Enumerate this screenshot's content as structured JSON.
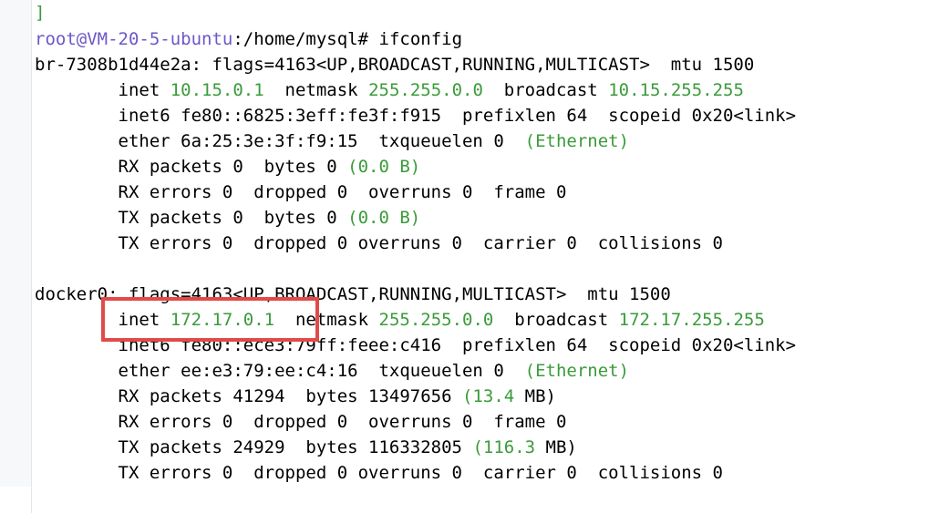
{
  "terminal": {
    "top_bracket": "]",
    "prompt": {
      "user_host": "root@VM-20-5-ubuntu",
      "path": ":/home/mysql#",
      "command": " ifconfig"
    },
    "br": {
      "header": "br-7308b1d44e2a: flags=4163<UP,BROADCAST,RUNNING,MULTICAST>  mtu 1500",
      "inet_label": "        inet ",
      "inet_ip": "10.15.0.1",
      "netmask_label": "  netmask ",
      "netmask_value": "255.255.0.0",
      "broadcast_label": "  broadcast ",
      "broadcast_value": "10.15.255.255",
      "inet6": "        inet6 fe80::6825:3eff:fe3f:f915  prefixlen 64  scopeid 0x20<link>",
      "ether": "        ether 6a:25:3e:3f:f9:15  txqueuelen 0  ",
      "ether_type": "(Ethernet)",
      "rx_packets": "        RX packets 0  bytes 0 ",
      "rx_size": "(0.0 B)",
      "rx_errors": "        RX errors 0  dropped 0  overruns 0  frame 0",
      "tx_packets": "        TX packets 0  bytes 0 ",
      "tx_size": "(0.0 B)",
      "tx_errors": "        TX errors 0  dropped 0 overruns 0  carrier 0  collisions 0"
    },
    "docker": {
      "header": "docker0: flags=4163<UP,BROADCAST,RUNNING,MULTICAST>  mtu 1500",
      "inet_label": "        inet ",
      "inet_ip": "172.17.0.1",
      "netmask_label": "  netmask ",
      "netmask_value": "255.255.0.0",
      "broadcast_label": "  broadcast ",
      "broadcast_value": "172.17.255.255",
      "inet6": "        inet6 fe80::ece3:79ff:feee:c416  prefixlen 64  scopeid 0x20<link>",
      "ether": "        ether ee:e3:79:ee:c4:16  txqueuelen 0  ",
      "ether_type": "(Ethernet)",
      "rx_packets": "        RX packets 41294  bytes 13497656 ",
      "rx_size_num": "(13.4",
      "rx_size_unit": " MB)",
      "rx_errors": "        RX errors 0  dropped 0  overruns 0  frame 0",
      "tx_packets": "        TX packets 24929  bytes 116332805 ",
      "tx_size_num": "(116.3",
      "tx_size_unit": " MB)",
      "tx_errors": "        TX errors 0  dropped 0 overruns 0  carrier 0  collisions 0"
    },
    "colors": {
      "green": "#3a9b3a",
      "prompt_purple": "#6e57c6",
      "highlight_red": "#e24a4a"
    }
  }
}
